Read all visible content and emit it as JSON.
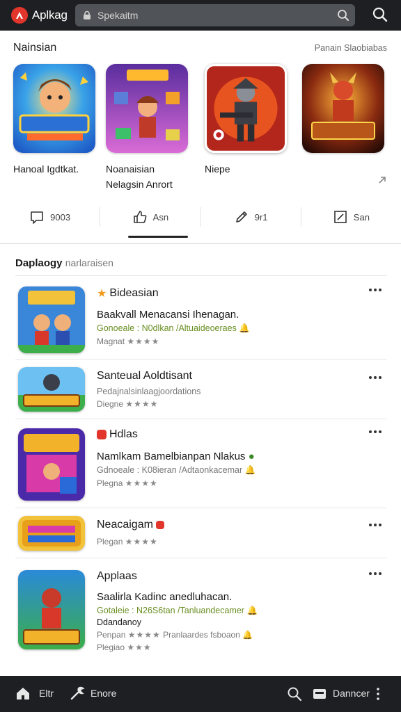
{
  "app": {
    "brand": "Aplkag"
  },
  "search": {
    "placeholder": "Spekaitm"
  },
  "featured": {
    "title": "Nainsian",
    "meta": "Panain Slaobiabas",
    "cards": [
      {
        "label": "Hanoal Igdtkat.",
        "label2": ""
      },
      {
        "label": "Noanaisian",
        "label2": "Nelagsin Anrort"
      },
      {
        "label": "Niepe",
        "label2": ""
      },
      {
        "label": "",
        "label2": ""
      }
    ]
  },
  "actions": [
    {
      "label": "9003",
      "icon": "chat-bubble-icon"
    },
    {
      "label": "Asn",
      "icon": "thumbs-up-icon"
    },
    {
      "label": "9r1",
      "icon": "edit-pencil-icon"
    },
    {
      "label": "San",
      "icon": "compose-icon"
    }
  ],
  "list": {
    "title": "Daplaogy",
    "subtitle": "narlaraisen",
    "items": [
      {
        "name": "Bideasian",
        "desc": "Baakvall Menacansi Ihenagan.",
        "sub": "Gonoeale : N0dlkan /Altuaideoeraes",
        "rate_label": "Magnat",
        "stars": "★★★★"
      },
      {
        "name": "Santeual Aoldtisant",
        "desc": "",
        "sub": "Pedajnalsinlaagjoordations",
        "rate_label": "Diegne",
        "stars": "★★★★"
      },
      {
        "name": "Hdlas",
        "desc": "Namlkam Bamelbianpan Nlakus",
        "sub": "Gdnoeale : K08ieran /Adtaonkacemar",
        "rate_label": "Plegna",
        "stars": "★★★★"
      },
      {
        "name": "Neacaigam",
        "desc": "",
        "sub": "",
        "rate_label": "Plegan",
        "stars": "★★★★"
      },
      {
        "name": "Applaas",
        "desc": "Saalirla Kadinc anedluhacan.",
        "sub": "Gotaleie : N26S6tan /Tanluandecamer",
        "sub2": "Ddandanoy",
        "rate_label": "Penpan",
        "stars": "★★★★",
        "extra": "Pranlaardes fsboaon",
        "rate_label2": "Plegiao",
        "stars2": "★★★"
      }
    ]
  },
  "bottom": {
    "home": "Eltr",
    "tools": "Enore",
    "downloads": "Danncer"
  },
  "colors": {
    "bar": "#1e1f22",
    "accent": "#e2352b",
    "green_text": "#6b8f23"
  }
}
